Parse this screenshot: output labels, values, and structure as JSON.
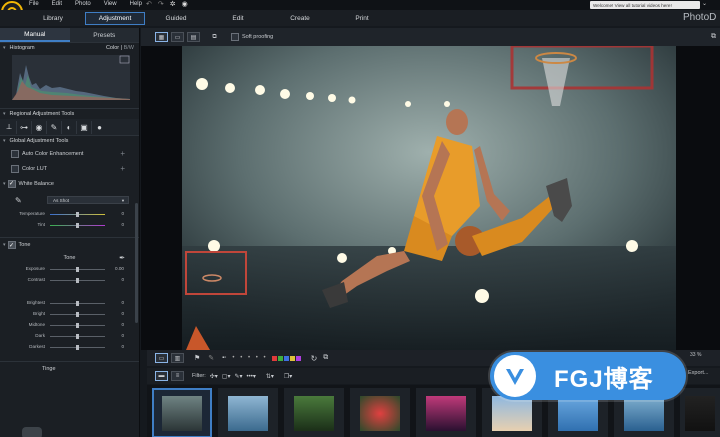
{
  "menu": {
    "items": [
      "File",
      "Edit",
      "Photo",
      "View",
      "Help"
    ]
  },
  "welcome_text": "Welcome! View all tutorial videos here!",
  "modules": {
    "library": "Library",
    "adjustment": "Adjustment",
    "guided": "Guided",
    "edit": "Edit",
    "create": "Create",
    "print": "Print"
  },
  "brand": "PhotoD",
  "panel_tabs": {
    "manual": "Manual",
    "presets": "Presets"
  },
  "histogram": {
    "label": "Histogram",
    "color": "Color",
    "bw": "B/W"
  },
  "regional": {
    "label": "Regional Adjustment Tools"
  },
  "global": {
    "label": "Global Adjustment Tools"
  },
  "auto_color": "Auto Color Enhancement",
  "color_lut": "Color LUT",
  "white_balance": {
    "label": "White Balance",
    "preset": "As Shot",
    "sliders": [
      {
        "label": "Temperature",
        "value": "0"
      },
      {
        "label": "Tint",
        "value": "0"
      }
    ]
  },
  "tone": {
    "label": "Tone",
    "sub": "Tone",
    "sliders": [
      {
        "label": "Exposure",
        "value": "0.00"
      },
      {
        "label": "Contrast",
        "value": "0"
      }
    ],
    "sliders2": [
      {
        "label": "Brightest",
        "value": "0"
      },
      {
        "label": "Bright",
        "value": "0"
      },
      {
        "label": "Midtone",
        "value": "0"
      },
      {
        "label": "Dark",
        "value": "0"
      },
      {
        "label": "Darkest",
        "value": "0"
      }
    ]
  },
  "tinge": {
    "label": "Tinge"
  },
  "viewbar": {
    "soft_proofing": "Soft proofing"
  },
  "filterbar": {
    "filter": "Filter:"
  },
  "zoom": "33 %",
  "export": "Export...",
  "watermark": {
    "text": "FGJ博客"
  },
  "colors": {
    "accent": "#3f7ec5",
    "logo": "#f2b705",
    "watermark": "#3a8fe0"
  },
  "label_colors": [
    "#e03b3b",
    "#3fae3f",
    "#3f6fe0",
    "#e0c23b",
    "#b03fe0"
  ]
}
